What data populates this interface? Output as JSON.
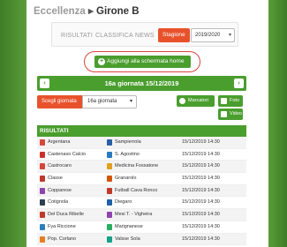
{
  "header": {
    "championship": "Eccellenza",
    "separator": "▸",
    "group": "Girone B"
  },
  "nav": {
    "items": [
      "RISULTATI",
      "CLASSIFICA",
      "NEWS"
    ],
    "season_button": "Stagione",
    "season_value": "2019/2020"
  },
  "add_home_label": "Aggiungi alla schermata home",
  "round_title": "16a giornata 15/12/2019",
  "picker": {
    "label": "Scegli giornata",
    "value": "16a giornata"
  },
  "buttons": {
    "scorers": "Marcatori",
    "photos": "Foto",
    "videos": "Video"
  },
  "results": {
    "title": "RISULTATI",
    "matches": [
      {
        "home": "Argentana",
        "away": "Sampierrola",
        "datetime": "15/12/2019 14:30",
        "home_color": "#d9453b",
        "away_color": "#2a5fa8"
      },
      {
        "home": "Castenaso Calcio",
        "away": "S. Agostino",
        "datetime": "15/12/2019 14:30",
        "home_color": "#c9302c",
        "away_color": "#2a7ac0"
      },
      {
        "home": "Castrocaro",
        "away": "Medicina Fossatone",
        "datetime": "15/12/2019 14:30",
        "home_color": "#d9453b",
        "away_color": "#e0a020"
      },
      {
        "home": "Classe",
        "away": "Granarolo",
        "datetime": "15/12/2019 14:30",
        "home_color": "#c0392b",
        "away_color": "#d35400"
      },
      {
        "home": "Copparese",
        "away": "Futball Cava Ronco",
        "datetime": "15/12/2019 14:30",
        "home_color": "#8e44ad",
        "away_color": "#c0392b"
      },
      {
        "home": "Cotignola",
        "away": "Diegaro",
        "datetime": "15/12/2019 14:30",
        "home_color": "#2c3e50",
        "away_color": "#1e5fa8"
      },
      {
        "home": "Del Duca Ribelle",
        "away": "Mesi T. - Vigheira",
        "datetime": "15/12/2019 14:30",
        "home_color": "#c0392b",
        "away_color": "#8e44ad"
      },
      {
        "home": "Fya Riccione",
        "away": "Marignanese",
        "datetime": "15/12/2019 14:30",
        "home_color": "#2980b9",
        "away_color": "#27ae60"
      },
      {
        "home": "Pop. Corlano",
        "away": "Valsse Sola",
        "datetime": "15/12/2019 14:30",
        "home_color": "#e67e22",
        "away_color": "#16a085"
      }
    ]
  }
}
